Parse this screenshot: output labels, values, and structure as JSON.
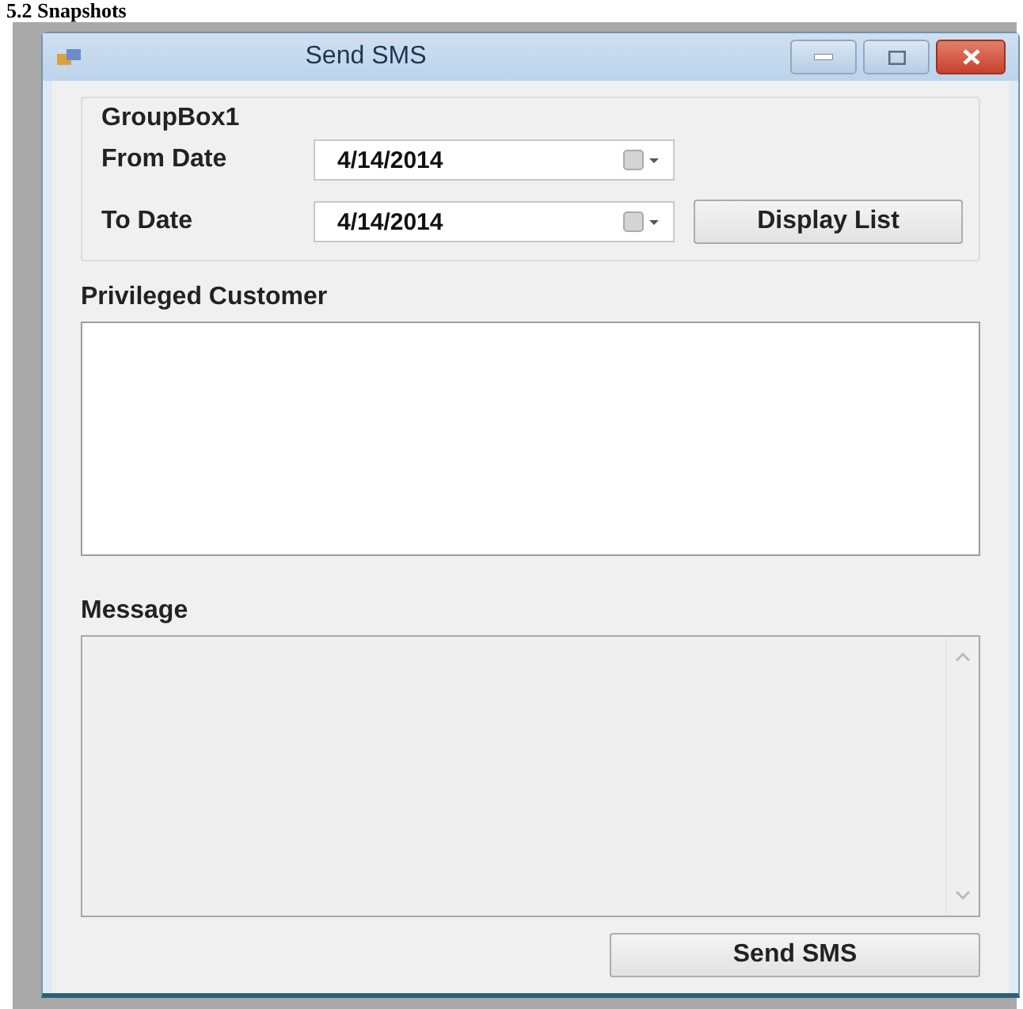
{
  "document": {
    "heading": "5.2 Snapshots"
  },
  "window": {
    "title": "Send SMS"
  },
  "group_box": {
    "title": "GroupBox1",
    "from_date": {
      "label": "From Date",
      "value": "4/14/2014"
    },
    "to_date": {
      "label": "To Date",
      "value": "4/14/2014"
    },
    "display_button": "Display List"
  },
  "customers": {
    "label": "Privileged Customer"
  },
  "message": {
    "label": "Message",
    "disabled": true
  },
  "send_button": "Send SMS"
}
